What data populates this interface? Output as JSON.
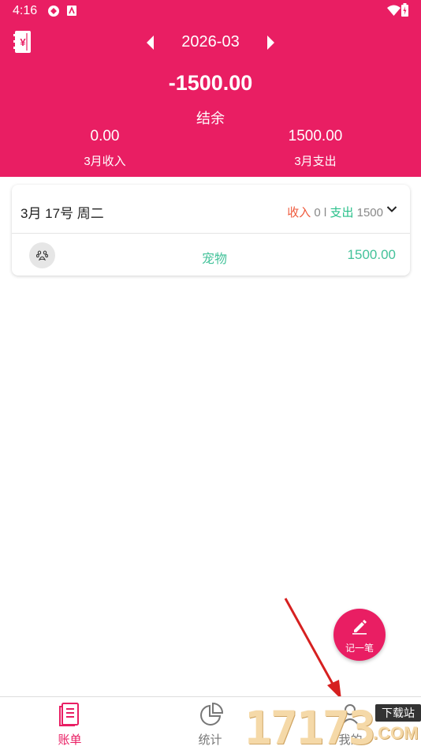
{
  "status_bar": {
    "time": "4:16"
  },
  "header": {
    "month": "2026-03",
    "balance": "-1500.00",
    "balance_label": "结余",
    "income": "0.00",
    "income_label": "3月收入",
    "expense": "1500.00",
    "expense_label": "3月支出",
    "book_icon": "ledger-book-icon",
    "brand_color": "#e91e63"
  },
  "days": [
    {
      "date": "3月 17号 周二",
      "income_label": "收入",
      "income_value": "0",
      "separator": "l",
      "expense_label": "支出",
      "expense_value": "1500",
      "entries": [
        {
          "icon": "paw-icon",
          "category": "宠物",
          "amount": "1500.00"
        }
      ]
    }
  ],
  "fab": {
    "label": "记一笔",
    "icon": "pen-icon"
  },
  "nav": [
    {
      "label": "账单",
      "icon": "bill-icon",
      "active": true
    },
    {
      "label": "统计",
      "icon": "pie-chart-icon",
      "active": false
    },
    {
      "label": "我的",
      "icon": "person-icon",
      "active": false
    }
  ],
  "watermark": {
    "digits": "17173",
    "badge": "下载站",
    "domain": ".COM"
  },
  "colors": {
    "income": "#ef5a3c",
    "expense": "#29c08a",
    "entry": "#43c29a"
  }
}
